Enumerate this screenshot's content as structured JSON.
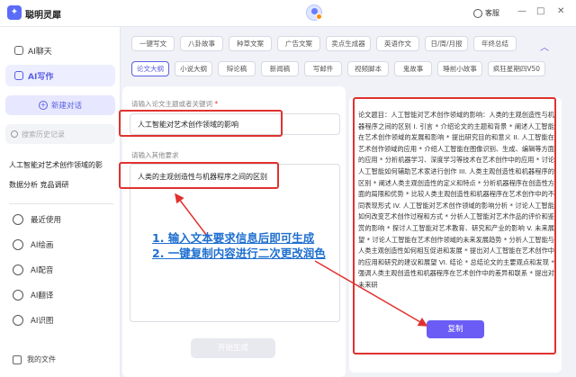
{
  "app": {
    "title": "聪明灵犀",
    "support_label": "客服",
    "window_controls": [
      "—",
      "□",
      "✕"
    ]
  },
  "sidebar": {
    "nav": [
      {
        "label": "AI聊天",
        "icon": "chat-icon"
      },
      {
        "label": "AI写作",
        "icon": "pen-icon",
        "active": true
      }
    ],
    "new_chat": "新建对话",
    "history_search_placeholder": "搜索历史记录",
    "history": [
      "人工智能对艺术创作领域的影",
      "数据分析 竞品调研"
    ],
    "tools": [
      {
        "label": "最近使用",
        "icon": "clock-icon"
      },
      {
        "label": "AI绘画",
        "icon": "brush-icon"
      },
      {
        "label": "AI配音",
        "icon": "audio-icon"
      },
      {
        "label": "AI翻译",
        "icon": "translate-icon"
      },
      {
        "label": "AI识图",
        "icon": "image-icon"
      }
    ],
    "my_files": "我的文件"
  },
  "tags_row1": [
    "一键写文",
    "八卦故事",
    "种草文案",
    "广告文案",
    "卖点生成器",
    "英语作文",
    "日/周/月报",
    "年终总结"
  ],
  "tags_row2": [
    "论文大纲",
    "小说大纲",
    "辩论稿",
    "新闻稿",
    "写邮件",
    "视频脚本",
    "鬼故事",
    "睡前小故事",
    "疯狂星期四V50"
  ],
  "active_tag": "论文大纲",
  "form": {
    "topic_label": "请输入论文主题或者关键词",
    "topic_value": "人工智能对艺术创作领域的影响",
    "other_label": "请输入其他要求",
    "other_value": "人类的主观创造性与机器程序之间的区别",
    "generate_button": "开始生成"
  },
  "output": {
    "text": "论文题目：人工智能对艺术创作领域的影响：人类的主观创造性与机器程序之间的区别 I. 引言 * 介绍论文的主题和背景 * 阐述人工智能在艺术创作领域的发展和影响 * 提出研究目的和意义 II. 人工智能在艺术创作领域的应用 * 介绍人工智能在图像识别、生成、编辑等方面的应用 * 分析机器学习、深度学习等技术在艺术创作中的应用 * 讨论人工智能如何辅助艺术家进行创作 III. 人类主观创造性和机器程序的区别 * 阐述人类主观创造性的定义和特点 * 分析机器程序在创造性方面的局限和优势 * 比较人类主观创造性和机器程序在艺术创作中的不同表现形式 IV. 人工智能对艺术创作领域的影响分析 * 讨论人工智能如何改变艺术创作过程和方式 * 分析人工智能对艺术作品的评价和鉴赏的影响 * 探讨人工智能对艺术教育、研究和产业的影响 V. 未来展望 * 讨论人工智能在艺术创作领域的未来发展趋势 * 分析人工智能与人类主观创造性如何相互促进和发展 * 提出对人工智能在艺术创作中的应用和研究的建议和展望 VI. 结论 * 总结论文的主要观点和发现 * 强调人类主观创造性和机器程序在艺术创作中的差异和联系 * 提出对未来研",
    "copy_button": "复制"
  },
  "annotation": {
    "line1": "1. 输入文本要求信息后即可生成",
    "line2": "2. 一键复制内容进行二次更改润色",
    "color": "#1e6fd0",
    "highlight_color": "#e0322f"
  }
}
